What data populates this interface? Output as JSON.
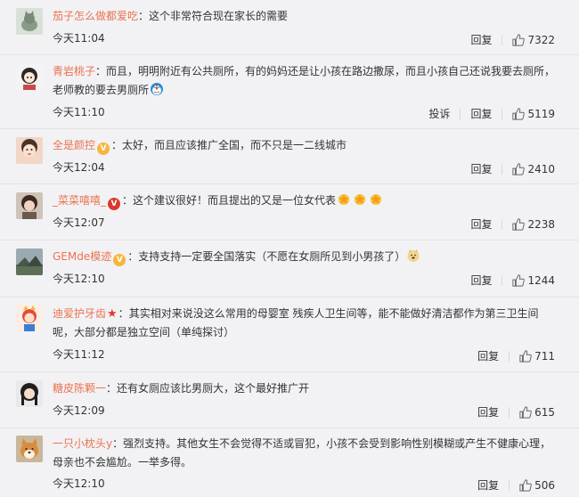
{
  "colors": {
    "username": "#eb7350",
    "text": "#333333",
    "background": "#f2f2f5",
    "divider": "#e3e3e6"
  },
  "actions": {
    "reply_label": "回复",
    "report_label": "投诉"
  },
  "comments": [
    {
      "username": "茄子怎么做都爱吃",
      "text": "这个非常符合现在家长的需要",
      "time": "今天11:04",
      "likes": "7322",
      "avatar_icon": "cat-avatar-icon"
    },
    {
      "username": "青岩桃子",
      "text_line1": "而且，明明附近有公共厕所，有的妈妈还是让小孩在路边撒尿，而且小孩自己还说我要去厕所，",
      "text_line2": "老师教的要去男厕所",
      "time": "今天11:10",
      "likes": "5119",
      "avatar_icon": "cartoon-girl-avatar-icon",
      "trailing_emoji": "doraemon-emoji-icon"
    },
    {
      "username": "全是颜控",
      "badge": "V",
      "text": "太好，而且应该推广全国，而不只是一二线城市",
      "time": "今天12:04",
      "likes": "2410",
      "avatar_icon": "girl-avatar-icon"
    },
    {
      "username": "_菜菜嘻嘻_",
      "badge": "V",
      "text": "这个建议很好！而且提出的又是一位女代表",
      "time": "今天12:07",
      "likes": "2238",
      "avatar_icon": "woman-avatar-icon",
      "trailing_emoji": "thumbs-up-emoji-icon"
    },
    {
      "username": "GEMde模迹",
      "badge": "V",
      "text": "支持支持一定要全国落实（不愿在女厕所见到小男孩了）",
      "time": "今天12:10",
      "likes": "1244",
      "avatar_icon": "landscape-avatar-icon",
      "trailing_emoji": "doge-emoji-icon"
    },
    {
      "username": "迪爱护牙齿",
      "text_line1": "其实相对来说没这么常用的母婴室 残疾人卫生间等，能不能做好清洁都作为第三卫生间",
      "text_line2": "呢，大部分都是独立空间（单纯探讨）",
      "time": "今天11:12",
      "likes": "711",
      "avatar_icon": "cartoon-avatar-icon"
    },
    {
      "username": "糖皮陈颗一",
      "text": "还有女厕应该比男厕大，这个最好推广开",
      "time": "今天12:09",
      "likes": "615",
      "avatar_icon": "dark-hair-avatar-icon"
    },
    {
      "username": "一只小枕头y",
      "text_line1": "强烈支持。其他女生不会觉得不适或冒犯，小孩不会受到影响性别模糊或产生不健康心理，",
      "text_line2": "母亲也不会尴尬。一举多得。",
      "time": "今天12:10",
      "likes": "506",
      "avatar_icon": "shiba-dog-avatar-icon"
    }
  ]
}
